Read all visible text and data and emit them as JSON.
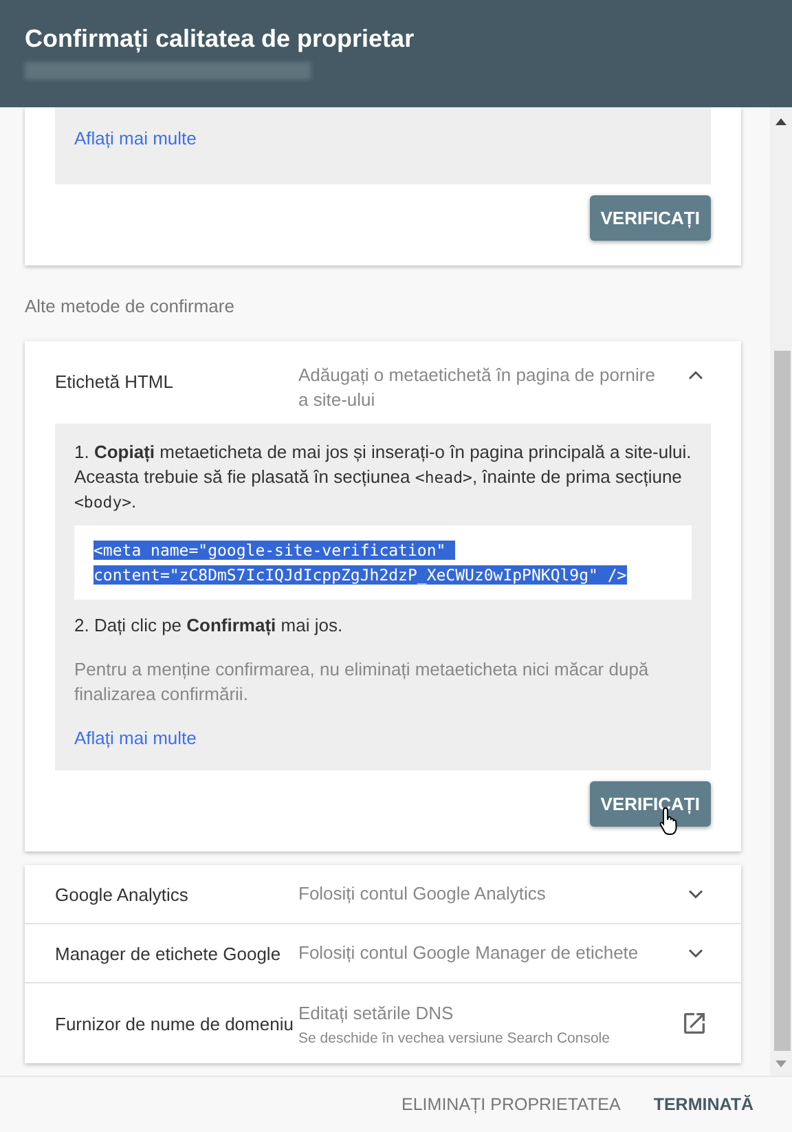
{
  "dialog": {
    "title": "Confirmați calitatea de proprietar"
  },
  "top_card": {
    "link": "Aflați mai multe",
    "button": "VERIFICAȚI"
  },
  "section_label": "Alte metode de confirmare",
  "methods": [
    {
      "kind": "expandable",
      "name": "Etichetă HTML",
      "description": "Adăugați o metaetichetă în pagina de pornire a site-ului",
      "expanded": true,
      "details": {
        "step1": [
          {
            "kind": "text",
            "text": "1. **Copiați** metaeticheta de mai jos și inserați-o în pagina principală a site-ului. Aceasta trebuie să fie plasată în secțiunea "
          },
          {
            "kind": "code",
            "text": "<head>"
          },
          {
            "kind": "text",
            "text": ", înainte de prima secțiune "
          },
          {
            "kind": "code",
            "text": "<body>"
          },
          {
            "kind": "text",
            "text": "."
          }
        ],
        "code": {
          "lines": [
            "<meta name=\"google-site-verification\" ",
            "content=\"zC8DmS7IcIQJdIcppZgJh2dzP_XeCWUz0wIpPNKQl9g\" />"
          ],
          "selected": true
        },
        "step2": "2. Dați clic pe **Confirmați** mai jos.",
        "note": "Pentru a menține confirmarea, nu eliminați metaeticheta nici măcar după finalizarea confirmării.",
        "link": "Aflați mai multe",
        "button": "VERIFICAȚI"
      }
    },
    {
      "kind": "expandable",
      "name": "Google Analytics",
      "description": "Folosiți contul Google Analytics",
      "expanded": false
    },
    {
      "kind": "expandable",
      "name": "Manager de etichete Google",
      "description": "Folosiți contul Google Manager de etichete",
      "expanded": false
    },
    {
      "kind": "external",
      "name": "Furnizor de nume de domeniu",
      "description": "Editați setările DNS",
      "note": "Se deschide în vechea versiune Search Console"
    }
  ],
  "footer": {
    "buttons": [
      {
        "label": "ELIMINAȚI PROPRIETATEA",
        "primary": false
      },
      {
        "label": "TERMINATĂ",
        "primary": true
      }
    ]
  }
}
